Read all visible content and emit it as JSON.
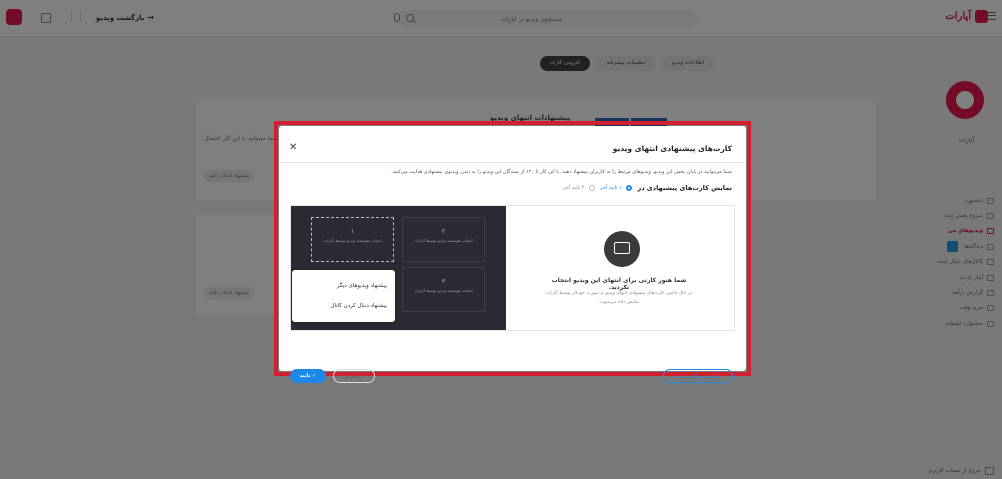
{
  "topbar": {
    "logo_text": "آپارات",
    "search_placeholder": "جستجوی ویدیو در آپارات",
    "back_label": "بازگشت ویدیو"
  },
  "sidebar": {
    "channel_name": "آپارات",
    "items": [
      {
        "label": "داشبورد",
        "active": false
      },
      {
        "label": "شروع پخش زنده",
        "active": false
      },
      {
        "label": "ویدیوهای من",
        "active": true
      },
      {
        "label": "دیدگاه‌ها",
        "active": false
      },
      {
        "label": "کانال‌های دنبال شده",
        "active": false
      },
      {
        "label": "آمار بازدید",
        "active": false
      },
      {
        "label": "گزارش درآمد",
        "active": false
      },
      {
        "label": "خرید وقت",
        "active": false
      },
      {
        "label": "جشنواره تبلیغات",
        "active": false
      }
    ],
    "bottom_item": "خروج از حساب کاربری"
  },
  "page": {
    "tabs": [
      {
        "label": "اطلاعات ویدیو",
        "active": false
      },
      {
        "label": "تنظیمات پیشرفته",
        "active": false
      },
      {
        "label": "افزودن کارت",
        "active": true
      }
    ],
    "section_title": "پیشنهادات انتهای ویدیو",
    "section_note": "شما میتوانید با این کار احتمال",
    "bg_button": "پیشنهاد انتخاب کنید"
  },
  "modal": {
    "title": "کارت‌های پیشنهادی انتهای ویدیو",
    "description": "شما می‌توانید در پایان بخش این ویدیو، ویدیوهای مرتبط را به کاربران پیشنهاد دهید. با این کار تا ۱۲۰ از بینندگان این ویدیو را به دیدن ویدیوی پیشنهادی هدایت می‌کنید.",
    "display_label": "نمایش کارت‌های پیشنهادی در",
    "radio_options": [
      {
        "label": "۱۰ ثانیه آخر",
        "checked": true
      },
      {
        "label": "۲۰ ثانیه آخر",
        "checked": false
      }
    ],
    "empty_title": "شما هنوز کارتی برای انتهای این ویدیو انتخاب نکردید.",
    "empty_subtitle": "در حال حاضر، کارت‌های پیشنهادی انتهای ویدیو به صورت خودکار توسط آپارات نمایش داده می‌شوند.",
    "slots": [
      {
        "number": "۱",
        "text": "انتخاب هوشمند ویدیو توسط آپارات"
      },
      {
        "number": "۲",
        "text": "انتخاب هوشمند ویدیو توسط آپارات"
      },
      {
        "number": "۳",
        "text": "انتخاب هوشمند ویدیو توسط آپارات"
      }
    ],
    "popup_menu": [
      "پیشنهاد ویدیوهای دیگر",
      "پیشنهاد دنبال کردن کانال"
    ],
    "add_card_label": "+ افزودن کارت جدید",
    "confirm_label": "✓ تایید",
    "cancel_label": "✕ انصراف"
  },
  "colors": {
    "brand": "#e8194f",
    "primary": "#1e88e5",
    "highlight": "#d32030"
  }
}
